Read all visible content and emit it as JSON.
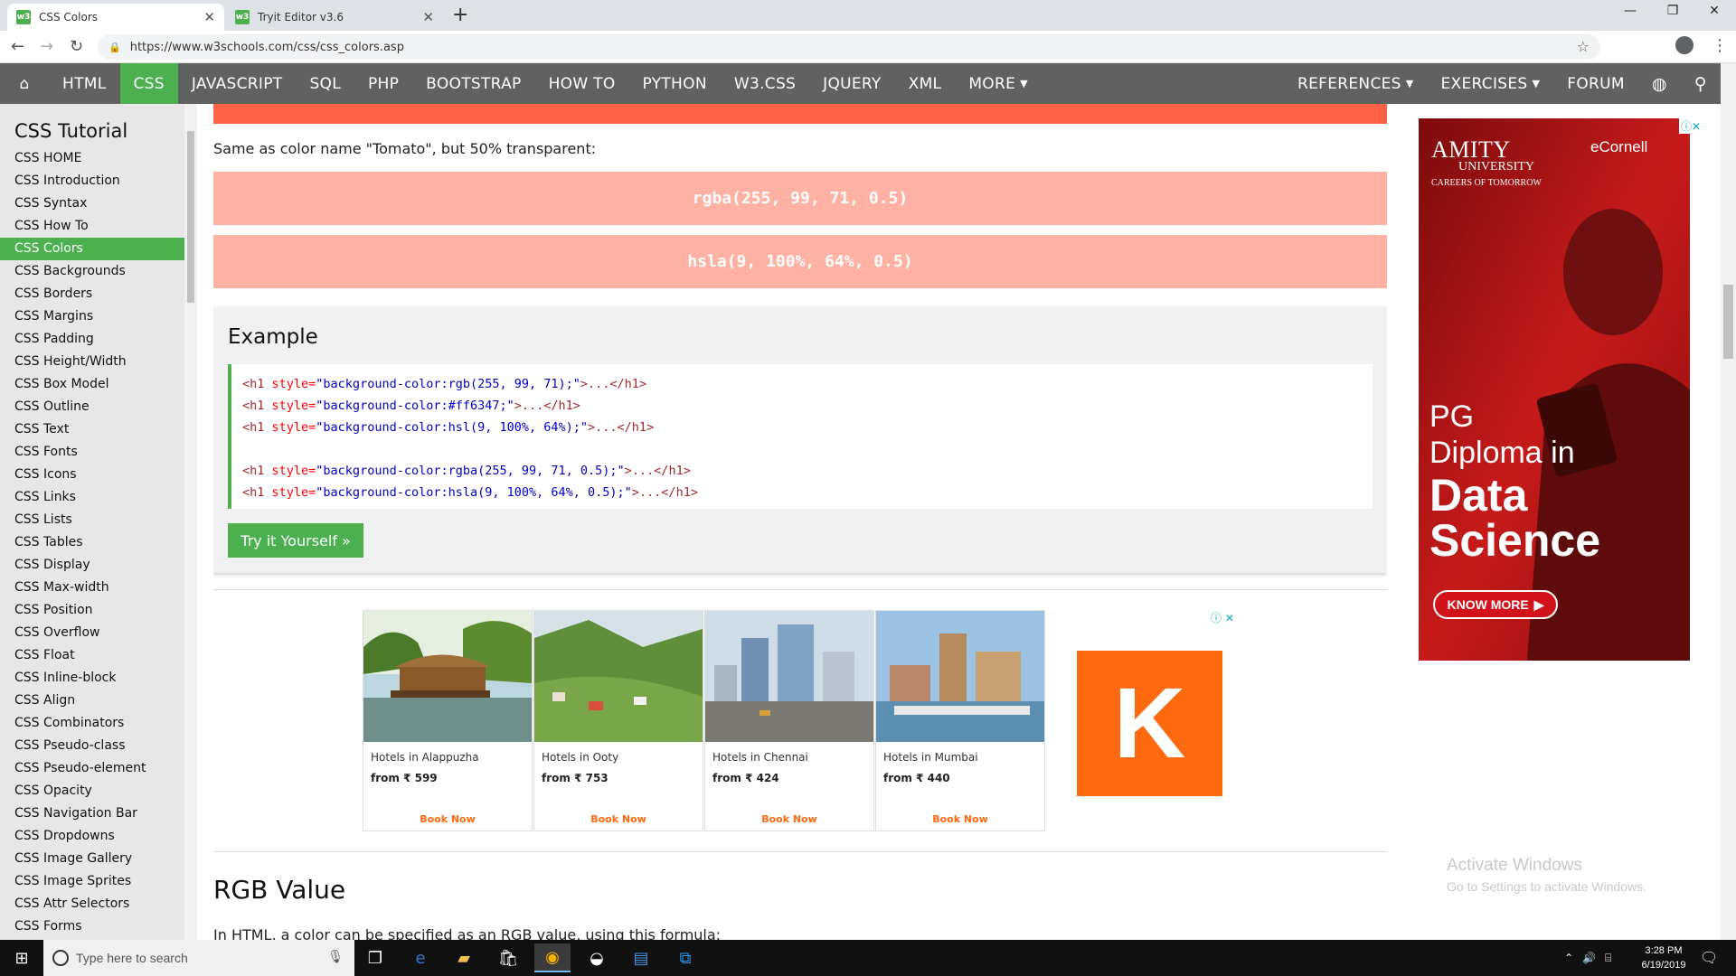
{
  "browser": {
    "tabs": [
      {
        "title": "CSS Colors",
        "favicon": "w3"
      },
      {
        "title": "Tryit Editor v3.6",
        "favicon": "w3"
      }
    ],
    "url": "https://www.w3schools.com/css/css_colors.asp"
  },
  "topnav": {
    "items": [
      "HTML",
      "CSS",
      "JAVASCRIPT",
      "SQL",
      "PHP",
      "BOOTSTRAP",
      "HOW TO",
      "PYTHON",
      "W3.CSS",
      "JQUERY",
      "XML",
      "MORE"
    ],
    "active": "CSS",
    "right_items": [
      "REFERENCES",
      "EXERCISES",
      "FORUM"
    ]
  },
  "sidebar": {
    "title": "CSS Tutorial",
    "items": [
      "CSS HOME",
      "CSS Introduction",
      "CSS Syntax",
      "CSS How To",
      "CSS Colors",
      "CSS Backgrounds",
      "CSS Borders",
      "CSS Margins",
      "CSS Padding",
      "CSS Height/Width",
      "CSS Box Model",
      "CSS Outline",
      "CSS Text",
      "CSS Fonts",
      "CSS Icons",
      "CSS Links",
      "CSS Lists",
      "CSS Tables",
      "CSS Display",
      "CSS Max-width",
      "CSS Position",
      "CSS Overflow",
      "CSS Float",
      "CSS Inline-block",
      "CSS Align",
      "CSS Combinators",
      "CSS Pseudo-class",
      "CSS Pseudo-element",
      "CSS Opacity",
      "CSS Navigation Bar",
      "CSS Dropdowns",
      "CSS Image Gallery",
      "CSS Image Sprites",
      "CSS Attr Selectors",
      "CSS Forms"
    ],
    "active": "CSS Colors"
  },
  "main": {
    "note": "Same as color name \"Tomato\", but 50% transparent:",
    "band_rgba": "rgba(255, 99, 71, 0.5)",
    "band_hsla": "hsla(9, 100%, 64%, 0.5)",
    "example_title": "Example",
    "code_lines": [
      {
        "tag_open": "<h1",
        "attr": " style=",
        "val": "\"background-color:rgb(255, 99, 71);\"",
        "rest": ">...</h1>"
      },
      {
        "tag_open": "<h1",
        "attr": " style=",
        "val": "\"background-color:#ff6347;\"",
        "rest": ">...</h1>"
      },
      {
        "tag_open": "<h1",
        "attr": " style=",
        "val": "\"background-color:hsl(9, 100%, 64%);\"",
        "rest": ">...</h1>"
      },
      {
        "tag_open": "",
        "attr": "",
        "val": "",
        "rest": ""
      },
      {
        "tag_open": "<h1",
        "attr": " style=",
        "val": "\"background-color:rgba(255, 99, 71, 0.5);\"",
        "rest": ">...</h1>"
      },
      {
        "tag_open": "<h1",
        "attr": " style=",
        "val": "\"background-color:hsla(9, 100%, 64%, 0.5);\"",
        "rest": ">...</h1>"
      }
    ],
    "try_button": "Try it Yourself »",
    "rgb_heading": "RGB Value",
    "rgb_intro": "In HTML, a color can be specified as an RGB value, using this formula:"
  },
  "hotel_ad": {
    "cards": [
      {
        "name": "Hotels in Alappuzha",
        "price": "from ₹ 599",
        "cta": "Book Now"
      },
      {
        "name": "Hotels in Ooty",
        "price": "from ₹ 753",
        "cta": "Book Now"
      },
      {
        "name": "Hotels in Chennai",
        "price": "from ₹ 424",
        "cta": "Book Now"
      },
      {
        "name": "Hotels in Mumbai",
        "price": "from ₹ 440",
        "cta": "Book Now"
      }
    ],
    "logo_letter": "K"
  },
  "right_ad": {
    "brand": "AMITY",
    "brand_sub": "UNIVERSITY",
    "tagline": "CAREERS OF TOMORROW",
    "partner": "eCornell",
    "line1": "PG",
    "line2": "Diploma in",
    "line3": "Data",
    "line4": "Science",
    "cta": "KNOW MORE"
  },
  "watermark": {
    "line1": "Activate Windows",
    "line2": "Go to Settings to activate Windows."
  },
  "taskbar": {
    "search_placeholder": "Type here to search",
    "time": "3:28 PM",
    "date": "6/19/2019"
  },
  "colors": {
    "w3_green": "#4caf50",
    "nav_gray": "#616161",
    "tomato": "#ff6347",
    "kayak_orange": "#ff690f"
  }
}
